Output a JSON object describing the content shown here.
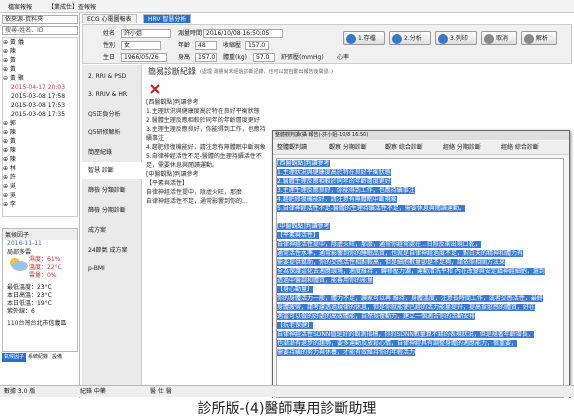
{
  "menu": [
    "檔案報報",
    "【業成仕】查報報",
    "",
    ""
  ],
  "left": {
    "select": "依來源-資料夾",
    "search": "搜尋-姓名、ID",
    "tree": [
      "⊕ 黃  儀",
      "⊕ 陳  ",
      "⊕ 黃  ",
      "⊕ 黃  ",
      "⊖ 黃  聚",
      "2015-04-17 20:03",
      "2015-03-08 17:58",
      "2015-03-08 17:53",
      "2015-03-08 17:35",
      "⊕ 郭  ",
      "⊕ 陳  ",
      "⊕ 黃  ",
      "⊕ 陳  ",
      "⊕ 陳  ",
      "⊕ 林  ",
      "⊕ 許  ",
      "⊕ 吳  ",
      "⊕ 吳  ",
      "⊕ 李  "
    ],
    "weather": {
      "title": "氣候因子",
      "date": "2016-11-11",
      "desc": "局部多雲",
      "humidity": "濕度：61%",
      "temp": "溫度：22°C",
      "rain": "雲量：0%",
      "maxtemp": "最低溫度：23°C",
      "mintemp": "本日高溫：23°C",
      "hum2": "本日低溫：19°C",
      "pm": "紫外線：6",
      "city": "110台灣台北市信義區",
      "tabs": [
        "氣候因子",
        "系統紀錄",
        "設備"
      ]
    }
  },
  "tabs": [
    "ECG 心電圖報表",
    "HRV 智慧分析"
  ],
  "patient": {
    "name_label": "姓名",
    "name": "許小姐",
    "date_label": "測量時間",
    "date": "2016/10/08 16:50:05",
    "sex_label": "性別",
    "sex": "女",
    "age_label": "年齡",
    "age": "48",
    "bp_label": "收縮壓",
    "bp": "157.0",
    "birth_label": "生日",
    "birth": "1966/05/26",
    "height_label": "身高",
    "height": "157.0",
    "weight_label": "體重(kg)",
    "weight": "57.0",
    "dbp_label": "舒張壓(mmHg)",
    "hr_label": "心率",
    "hr": "",
    "buttons": [
      "1.存檔",
      "2.分析",
      "3.列印",
      "取消",
      "解析"
    ]
  },
  "side": [
    "2. RRI & PSD",
    "3. RRIV & HR",
    "Q5正負分析",
    "Q5研修解析",
    "簡歷紀錄",
    "智慧 診斷",
    "篩檢 分類診斷",
    "篩檢 分期診斷",
    "成方案",
    "24節氣 成方案",
    "p-BMI"
  ],
  "panel_title": "簡易診斷紀錄",
  "panel_hint": "(處理 測量尚未經過診斷記錄，也可以當自動出報告後開發。)",
  "notes": [
    "[西醫觀點]判讀參考",
    "1.主理狀況與健康度高於特在良好平衡狀態",
    "2.醫體生理反應相較於同年的年齡層度更好",
    "3.主理生理反應良好，你能得到工作，也應持續事注",
    "4.趨肥修復機能好，請注意有無體眠中斷現象",
    "5.自律神經活性不足-醫體的生理持續活性不足，需要休息與閱讀運動。",
    "",
    "[中醫觀點]判讀參考",
    "【平素與活性】",
    "自律神經活性提中，陰虛火旺，那麼",
    "自律神經活性不足，通常影響到你的..."
  ],
  "popup": {
    "title": "整體觀判讀(攝 報告)-許小姐-10/8 16:50)",
    "buttons": [
      "整體觀判讀",
      "觀察 分期診斷",
      "觀察 綜合診斷",
      "經絡 分期診斷",
      "經絡 綜合診斷"
    ],
    "body": [
      "[西醫觀點]判讀參考",
      "1.主理狀況與健康度高於特在良好平衡狀態",
      "2.醫體生理反應相較於同年的年齡層度更好",
      "3.主理生理反應良好，你能得到工作，也應持續事注",
      "4.趨肥修復機能好，請注意有無體眠中斷現象",
      "5.自律神經活性不足-醫體的生理持續活性不足，需要休息與閱讀運動。",
      "",
      "[中醫觀點]判讀參考",
      "【平素與活性】",
      "自律神經活性提中，陰虛火旺，那麼，通常你經常處在...日照反衝出現口乾，",
      "通常活性水準，通常影響到你的睡眠品質，也就是自律神經過度不足，對白天的精神和體力有",
      "需要提供幫助，你的交感活性相對較高，但是細胞數量卻是不足夠，請依照相關方法來",
      "全為保護這化去適應環境，適度維持 ，轉移壓力源，運動清洗平和 內在改變與安定鎮神經細胞，還到",
      "透過中醫調和體質，能善用你的能量",
      "【身心動量】",
      "你的身體活力一般，體力不足，讀家可以再 維持，身體溫度，注意長時間工作，或者交感活性，最終",
      "身體疲勞，請考慮透過規律的休息，但是你就能使已經的活力能量提升，提高食慾感的體質，好在",
      "適當可以做的好處的高效體能，自然恢復動力，建立一個適合你的活動安排",
      "【抗老保健】",
      "自律神經活性SDNN值是好的觀測指標，你的SDNN數量算不錯的表現狀況，但是隨著年齡增長，",
      "也漸漸有退步的趨勢，要多運動及放鬆心情，自律神經具有調整身體的適應能力，很重要，",
      "需要持續的努力與休養，才能有效維持你的年輕活力"
    ]
  },
  "status": {
    "left": "數據 3.0 版",
    "mid": "紀錄 中藥",
    "right": "醫 仕 醫"
  },
  "caption": "診所版-(4)醫師專用診斷助理",
  "colors": {
    "accent": "#2a6fc9",
    "highlight": "#3a7bd5"
  }
}
